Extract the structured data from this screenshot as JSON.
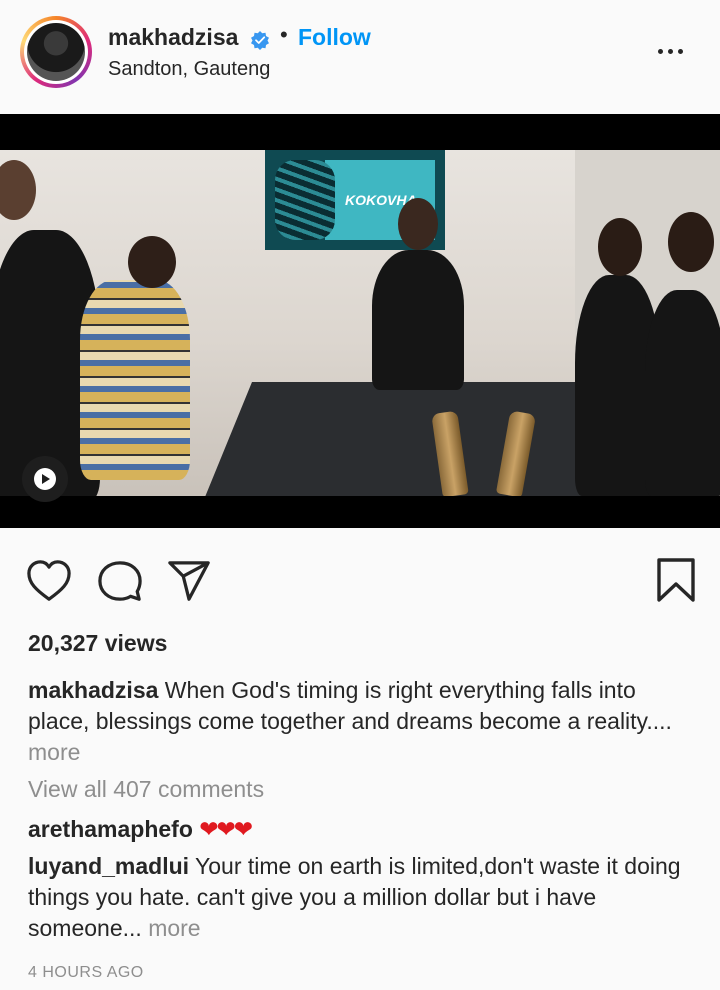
{
  "post": {
    "username": "makhadzisa",
    "separator": "•",
    "follow_label": "Follow",
    "location": "Sandton, Gauteng",
    "media": {
      "screen_text": "KOKOVHA"
    },
    "views": "20,327 views",
    "caption": {
      "author": "makhadzisa",
      "text": "When God's timing is right everything falls into place, blessings come together and dreams become a reality....",
      "more": "more"
    },
    "view_all_comments": "View all 407 comments",
    "comments": [
      {
        "author": "arethamaphefo",
        "text": "❤❤❤"
      },
      {
        "author": "luyand_madlui",
        "text": "Your time on earth is limited,don't waste it doing things you hate. can't give you a million dollar but i have someone...",
        "more": "more"
      }
    ],
    "time_ago": "4 HOURS AGO"
  },
  "colors": {
    "accent": "#0095f6",
    "text": "#262626",
    "secondary": "#8e8e8e",
    "heart": "#e0191f"
  },
  "icons": [
    "verified-badge-icon",
    "more-options-icon",
    "video-play-icon",
    "heart-icon",
    "comment-icon",
    "share-icon",
    "bookmark-icon"
  ]
}
